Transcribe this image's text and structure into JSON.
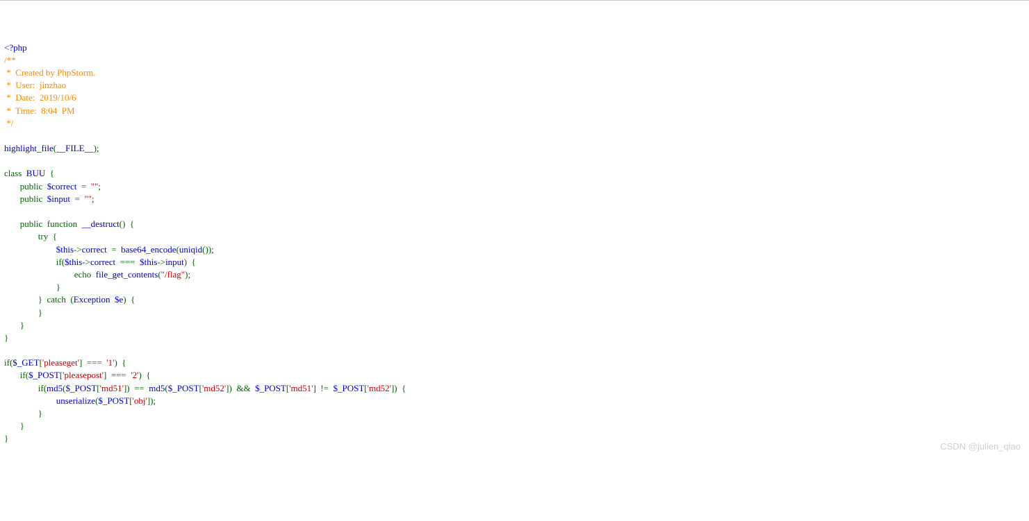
{
  "code": {
    "l0_a": "<?php",
    "l1_a": "/**",
    "l2_a": " *  Created by PhpStorm.",
    "l3_a": " *  User:  jinzhao",
    "l4_a": " *  Date:  2019/10/6",
    "l5_a": " *  Time:  8:04  PM",
    "l6_a": " */",
    "l8_a": "highlight_file",
    "l8_b": "(",
    "l8_c": "__FILE__",
    "l8_d": ");",
    "l10_a": "class  ",
    "l10_b": "BUU  ",
    "l10_c": "{",
    "l11_a": "       public  ",
    "l11_b": "$correct  ",
    "l11_c": "=  ",
    "l11_d": "\"\"",
    "l11_e": ";",
    "l12_a": "       public  ",
    "l12_b": "$input  ",
    "l12_c": "=  ",
    "l12_d": "\"\"",
    "l12_e": ";",
    "l14_a": "       public  function  ",
    "l14_b": "__destruct",
    "l14_c": "()  {",
    "l15_a": "               try  {",
    "l16_a": "                       ",
    "l16_b": "$this",
    "l16_c": "->",
    "l16_d": "correct  ",
    "l16_e": "=  ",
    "l16_f": "base64_encode",
    "l16_g": "(",
    "l16_h": "uniqid",
    "l16_i": "());",
    "l17_a": "                       if(",
    "l17_b": "$this",
    "l17_c": "->",
    "l17_d": "correct  ",
    "l17_e": "===  ",
    "l17_f": "$this",
    "l17_g": "->",
    "l17_h": "input",
    "l17_i": ")  {",
    "l18_a": "                               echo  ",
    "l18_b": "file_get_contents",
    "l18_c": "(",
    "l18_d": "\"/flag\"",
    "l18_e": ");",
    "l19_a": "                       }",
    "l20_a": "               }  catch  (",
    "l20_b": "Exception  $e",
    "l20_c": ")  {",
    "l21_a": "               }",
    "l22_a": "       }",
    "l23_a": "}",
    "l25_a": "if(",
    "l25_b": "$_GET",
    "l25_c": "[",
    "l25_d": "'pleaseget'",
    "l25_e": "]  ===  ",
    "l25_f": "'1'",
    "l25_g": ")  {",
    "l26_a": "       if(",
    "l26_b": "$_POST",
    "l26_c": "[",
    "l26_d": "'pleasepost'",
    "l26_e": "]  ===  ",
    "l26_f": "'2'",
    "l26_g": ")  {",
    "l27_a": "               if(",
    "l27_b": "md5",
    "l27_c": "(",
    "l27_d": "$_POST",
    "l27_e": "[",
    "l27_f": "'md51'",
    "l27_g": "])  ==  ",
    "l27_h": "md5",
    "l27_i": "(",
    "l27_j": "$_POST",
    "l27_k": "[",
    "l27_l": "'md52'",
    "l27_m": "])  &&  ",
    "l27_n": "$_POST",
    "l27_o": "[",
    "l27_p": "'md51'",
    "l27_q": "]  !=  ",
    "l27_r": "$_POST",
    "l27_s": "[",
    "l27_t": "'md52'",
    "l27_u": "])  {",
    "l28_a": "                       ",
    "l28_b": "unserialize",
    "l28_c": "(",
    "l28_d": "$_POST",
    "l28_e": "[",
    "l28_f": "'obj'",
    "l28_g": "]);",
    "l29_a": "               }",
    "l30_a": "       }",
    "l31_a": "}"
  },
  "watermark": "CSDN @julien_qiao"
}
